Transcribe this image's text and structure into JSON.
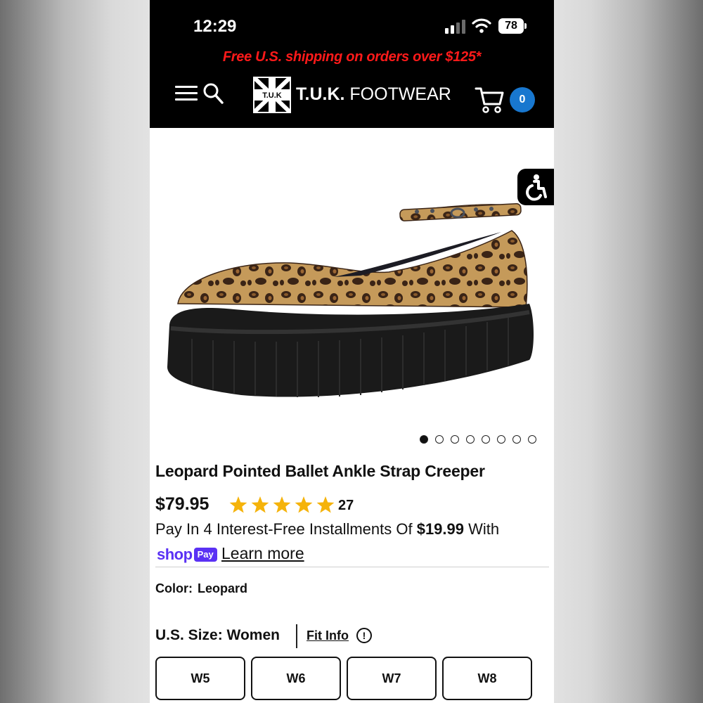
{
  "status_bar": {
    "time": "12:29",
    "battery": "78"
  },
  "promo_banner": {
    "text": "Free U.S. shipping on orders over $125*"
  },
  "header": {
    "logo_mark": "T.U.K",
    "brand_bold": "T.U.K.",
    "brand_regular": "FOOTWEAR",
    "cart_count": "0"
  },
  "product": {
    "title": "Leopard Pointed Ballet Ankle Strap Creeper",
    "price": "$79.95",
    "rating": 5,
    "review_count": "27",
    "installments_prefix": "Pay In 4 Interest-Free Installments Of ",
    "installment_amount": "$19.99",
    "installments_suffix": " With",
    "shop_word": "shop",
    "pay_word": "Pay",
    "learn_more": "Learn more",
    "carousel_total": 8,
    "carousel_active": 1
  },
  "color": {
    "label": "Color:",
    "value": "Leopard"
  },
  "size": {
    "label": "U.S. Size: Women",
    "fit_info": "Fit Info",
    "fit_icon": "!",
    "options": [
      "W5",
      "W6",
      "W7",
      "W8"
    ]
  },
  "colors": {
    "promo_red": "#ff1a1a",
    "cart_badge": "#1877cf",
    "star_gold": "#f5b30a",
    "shoppay_purple": "#5a31f4"
  },
  "icons": [
    "menu-icon",
    "search-icon",
    "cart-icon",
    "accessibility-icon",
    "star-icon",
    "info-icon"
  ]
}
